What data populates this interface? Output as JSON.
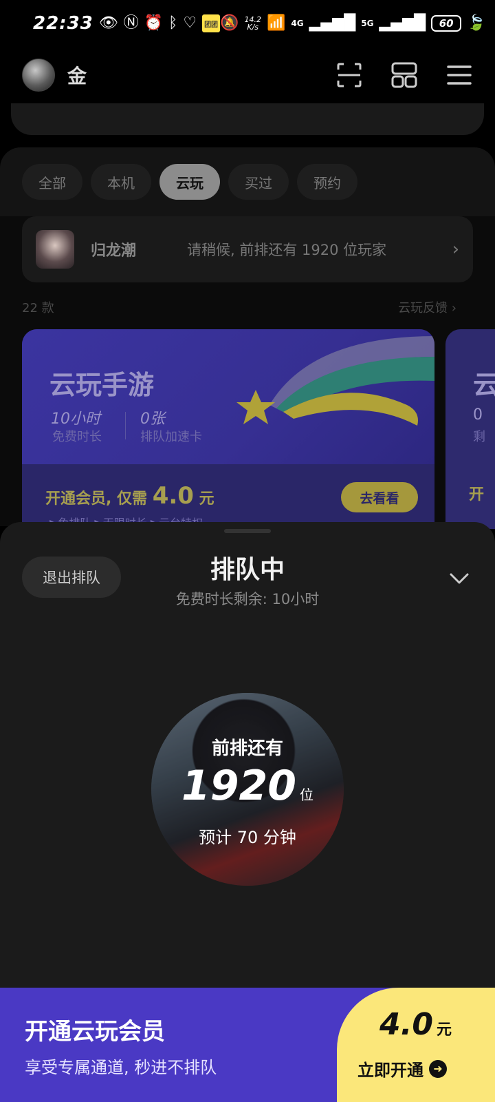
{
  "status_bar": {
    "time": "22:33",
    "speed_value": "14.2",
    "speed_unit": "K/s",
    "net_4g": "4G",
    "net_5g": "5G",
    "battery": "60",
    "badge_text": "团团"
  },
  "header": {
    "username": "金"
  },
  "tabs": [
    {
      "label": "全部"
    },
    {
      "label": "本机"
    },
    {
      "label": "云玩"
    },
    {
      "label": "买过"
    },
    {
      "label": "预约"
    }
  ],
  "queue_row": {
    "game_name": "归龙潮",
    "status_text": "请稍候, 前排还有 1920 位玩家"
  },
  "count_row": {
    "count": "22 款",
    "feedback": "云玩反馈"
  },
  "promo_card": {
    "title": "云玩手游",
    "stat1_value": "10小时",
    "stat1_label": "免费时长",
    "stat2_value": "0张",
    "stat2_label": "排队加速卡",
    "offer_prefix": "开通会员, 仅需",
    "offer_price": "4.0",
    "offer_unit": "元",
    "go_button": "去看看",
    "sub_text": "▶免排队  ▶无限时长  ▶云台特权"
  },
  "promo_card_2": {
    "title_partial": "云",
    "stat_partial": "0",
    "label_partial": "剩",
    "offer_partial": "开"
  },
  "sheet": {
    "exit_button": "退出排队",
    "title": "排队中",
    "subtitle": "免费时长剩余: 10小时",
    "front_label": "前排还有",
    "position": "1920",
    "position_unit": "位",
    "eta": "预计 70 分钟"
  },
  "banner": {
    "title": "开通云玩会员",
    "subtitle": "享受专属通道, 秒进不排队",
    "price": "4.0",
    "price_unit": "元",
    "cta": "立即开通"
  },
  "colors": {
    "background": "#000000",
    "sheet": "#1b1b1b",
    "promo_purple": "#2e2a6e",
    "banner_purple": "#4a39c4",
    "banner_yellow": "#fbe77a"
  }
}
